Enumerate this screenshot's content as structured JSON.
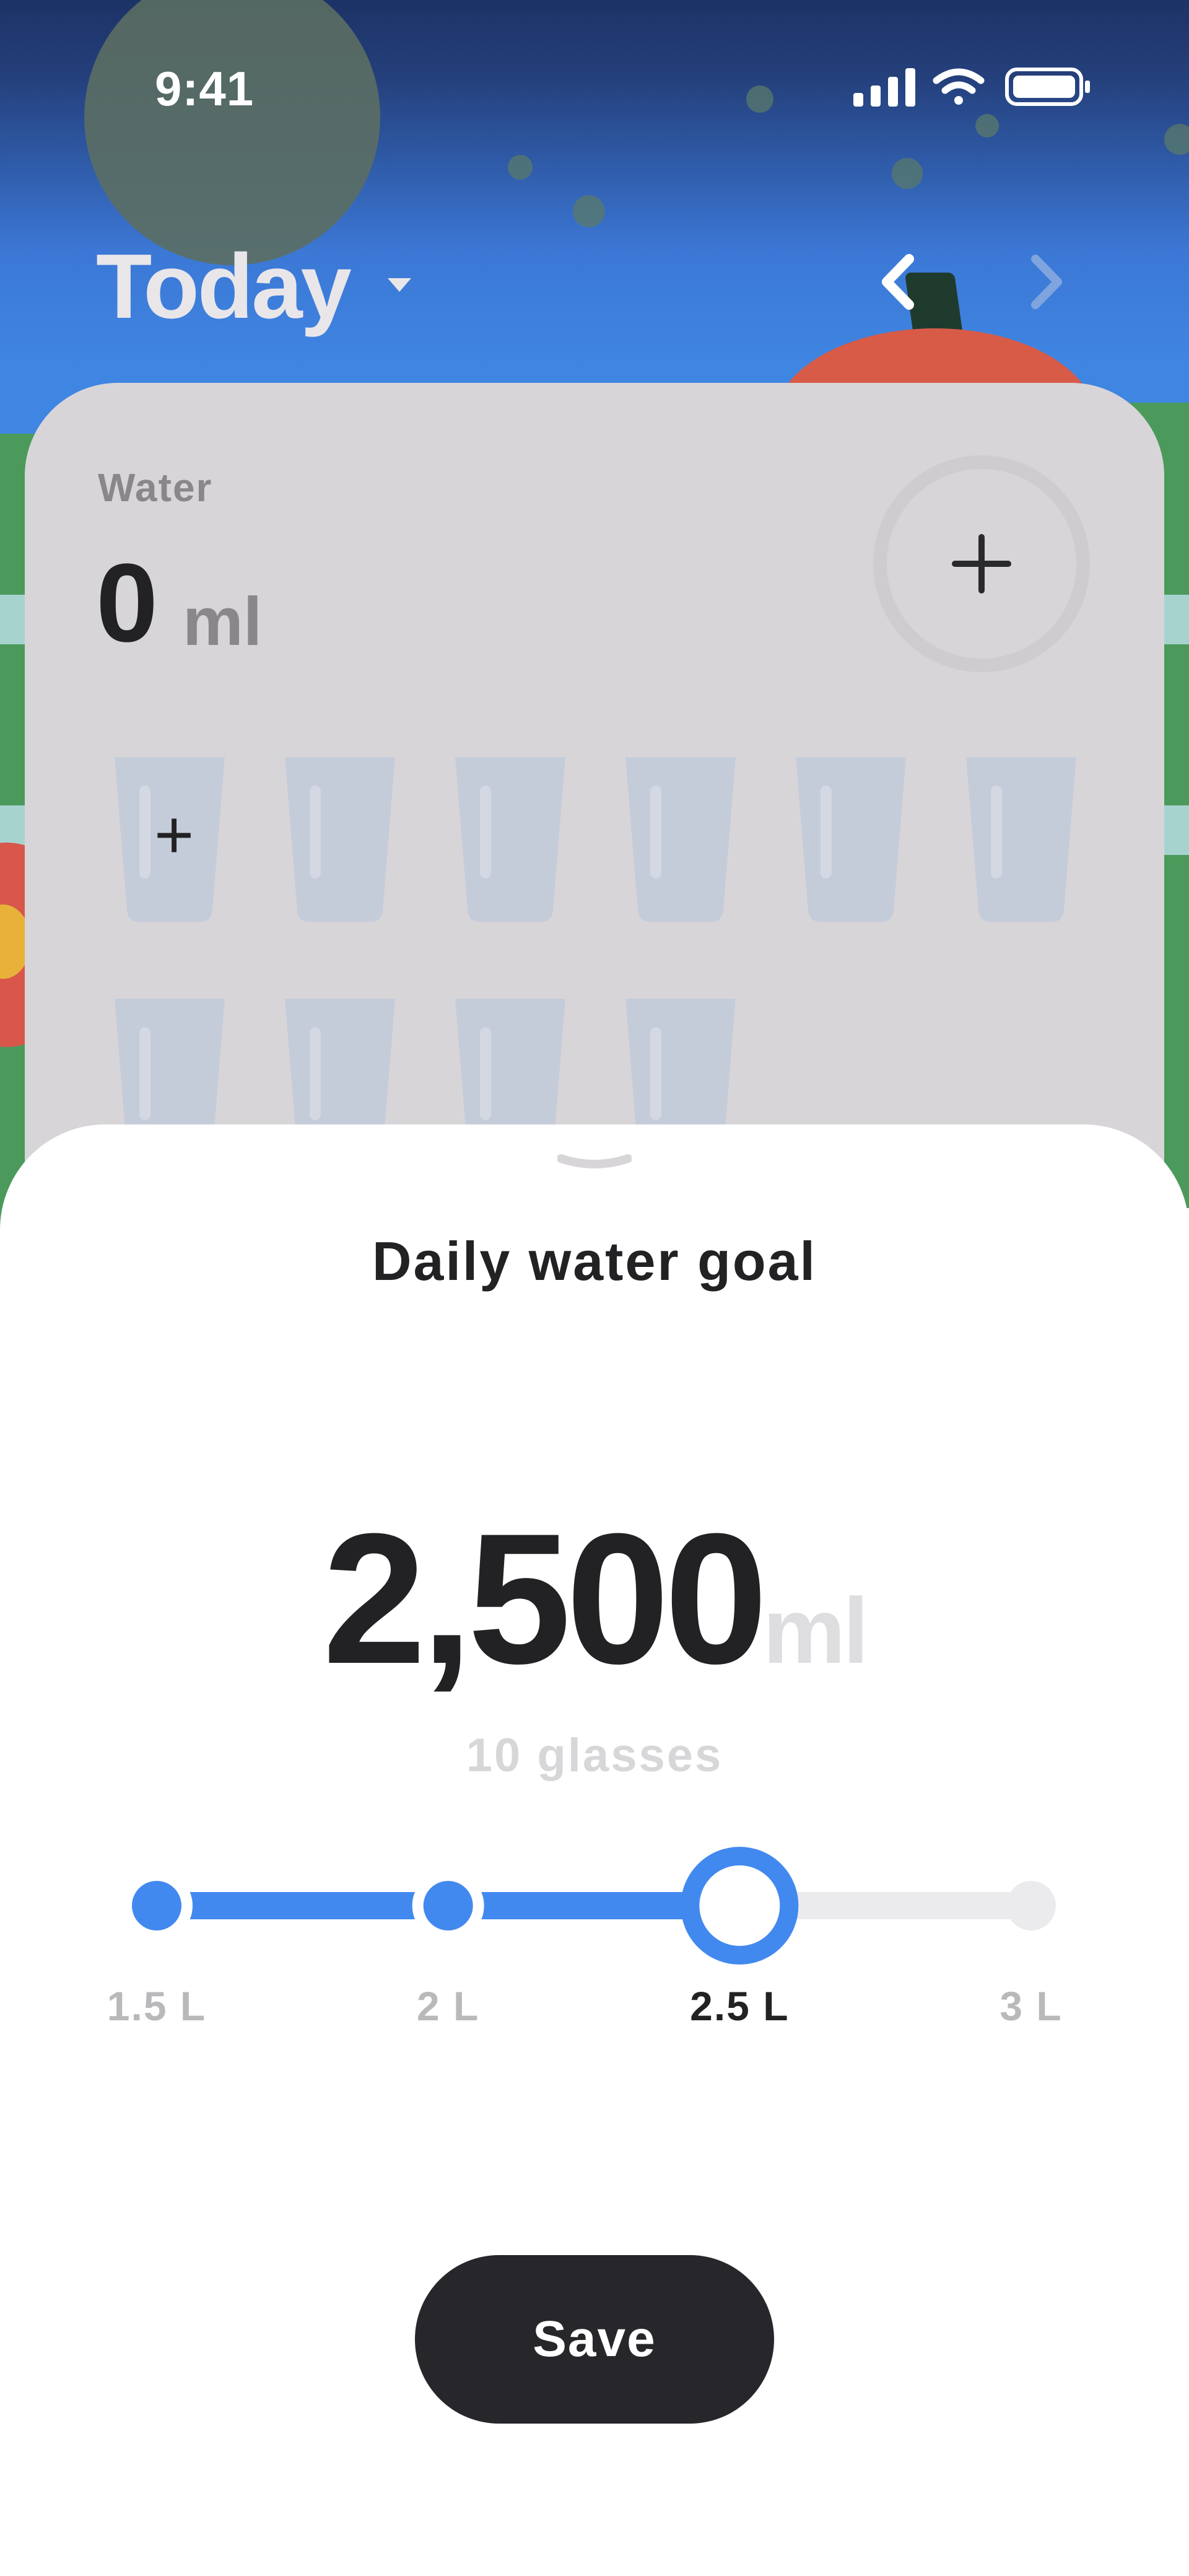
{
  "status_bar": {
    "time": "9:41",
    "icons": [
      "signal-icon",
      "wifi-icon",
      "battery-icon"
    ]
  },
  "header": {
    "title": "Today",
    "icons": [
      "caret-down-icon",
      "chevron-left-icon",
      "chevron-right-icon"
    ]
  },
  "water_card": {
    "label": "Water",
    "value": "0",
    "unit": "ml",
    "glass_count": 10,
    "filled_glasses": 0
  },
  "sheet": {
    "title": "Daily water goal",
    "goal_value": "2,500",
    "goal_unit": "ml",
    "glasses_text": "10 glasses",
    "slider": {
      "options": [
        "1.5 L",
        "2 L",
        "2.5 L",
        "3 L"
      ],
      "selected_index": 2
    },
    "save_label": "Save"
  },
  "colors": {
    "accent": "#4289ef",
    "dark": "#27262a",
    "card_bg": "#d8d5d9",
    "track_inactive": "#ebebed"
  }
}
